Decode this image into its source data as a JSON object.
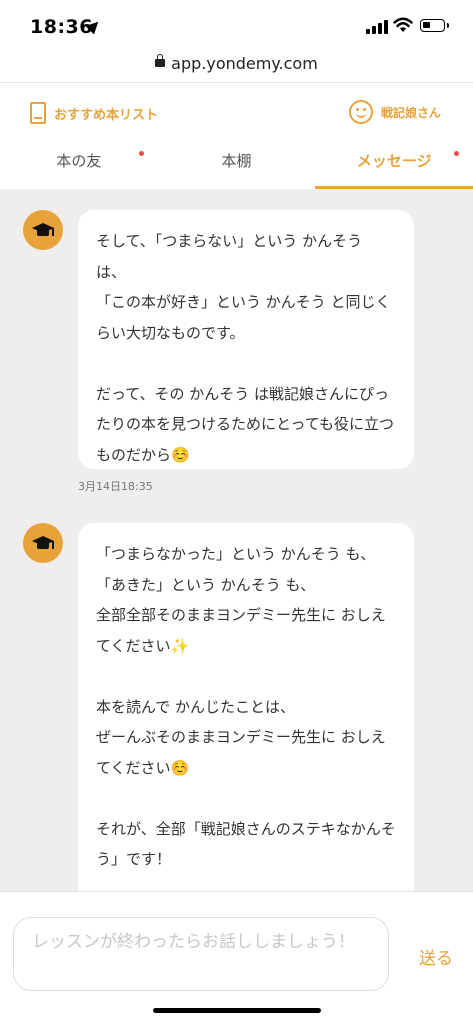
{
  "status_bar": {
    "time": "18:36"
  },
  "browser": {
    "url": "app.yondemy.com"
  },
  "header": {
    "recommended_list": "おすすめ本リスト",
    "user_name": "戦記娘さん"
  },
  "tabs": [
    {
      "label": "本の友",
      "has_badge": true,
      "active": false
    },
    {
      "label": "本棚",
      "has_badge": false,
      "active": false
    },
    {
      "label": "メッセージ",
      "has_badge": true,
      "active": true
    }
  ],
  "messages": [
    {
      "text": "そして、「つまらない」という かんそう は、\n「この本が好き」という かんそう と同じくらい大切なものです。\n\nだって、その かんそう は戦記娘さんにぴったりの本を見つけるためにとっても役に立つものだから☺️",
      "timestamp": "3月14日18:35"
    },
    {
      "text": "「つまらなかった」という かんそう も、\n「あきた」という かんそう も、\n全部全部そのままヨンデミー先生に おしえてください✨\n\n本を読んで かんじたことは、\nぜーんぶそのままヨンデミー先生に おしえてください☺️\n\nそれが、全部「戦記娘さんのステキなかんそう」です！",
      "timestamp": ""
    }
  ],
  "composer": {
    "placeholder": "レッスンが終わったらお話ししましょう！",
    "send_label": "送る"
  },
  "colors": {
    "accent": "#e8a23a",
    "badge": "#e84b4b",
    "background": "#efeeec"
  }
}
